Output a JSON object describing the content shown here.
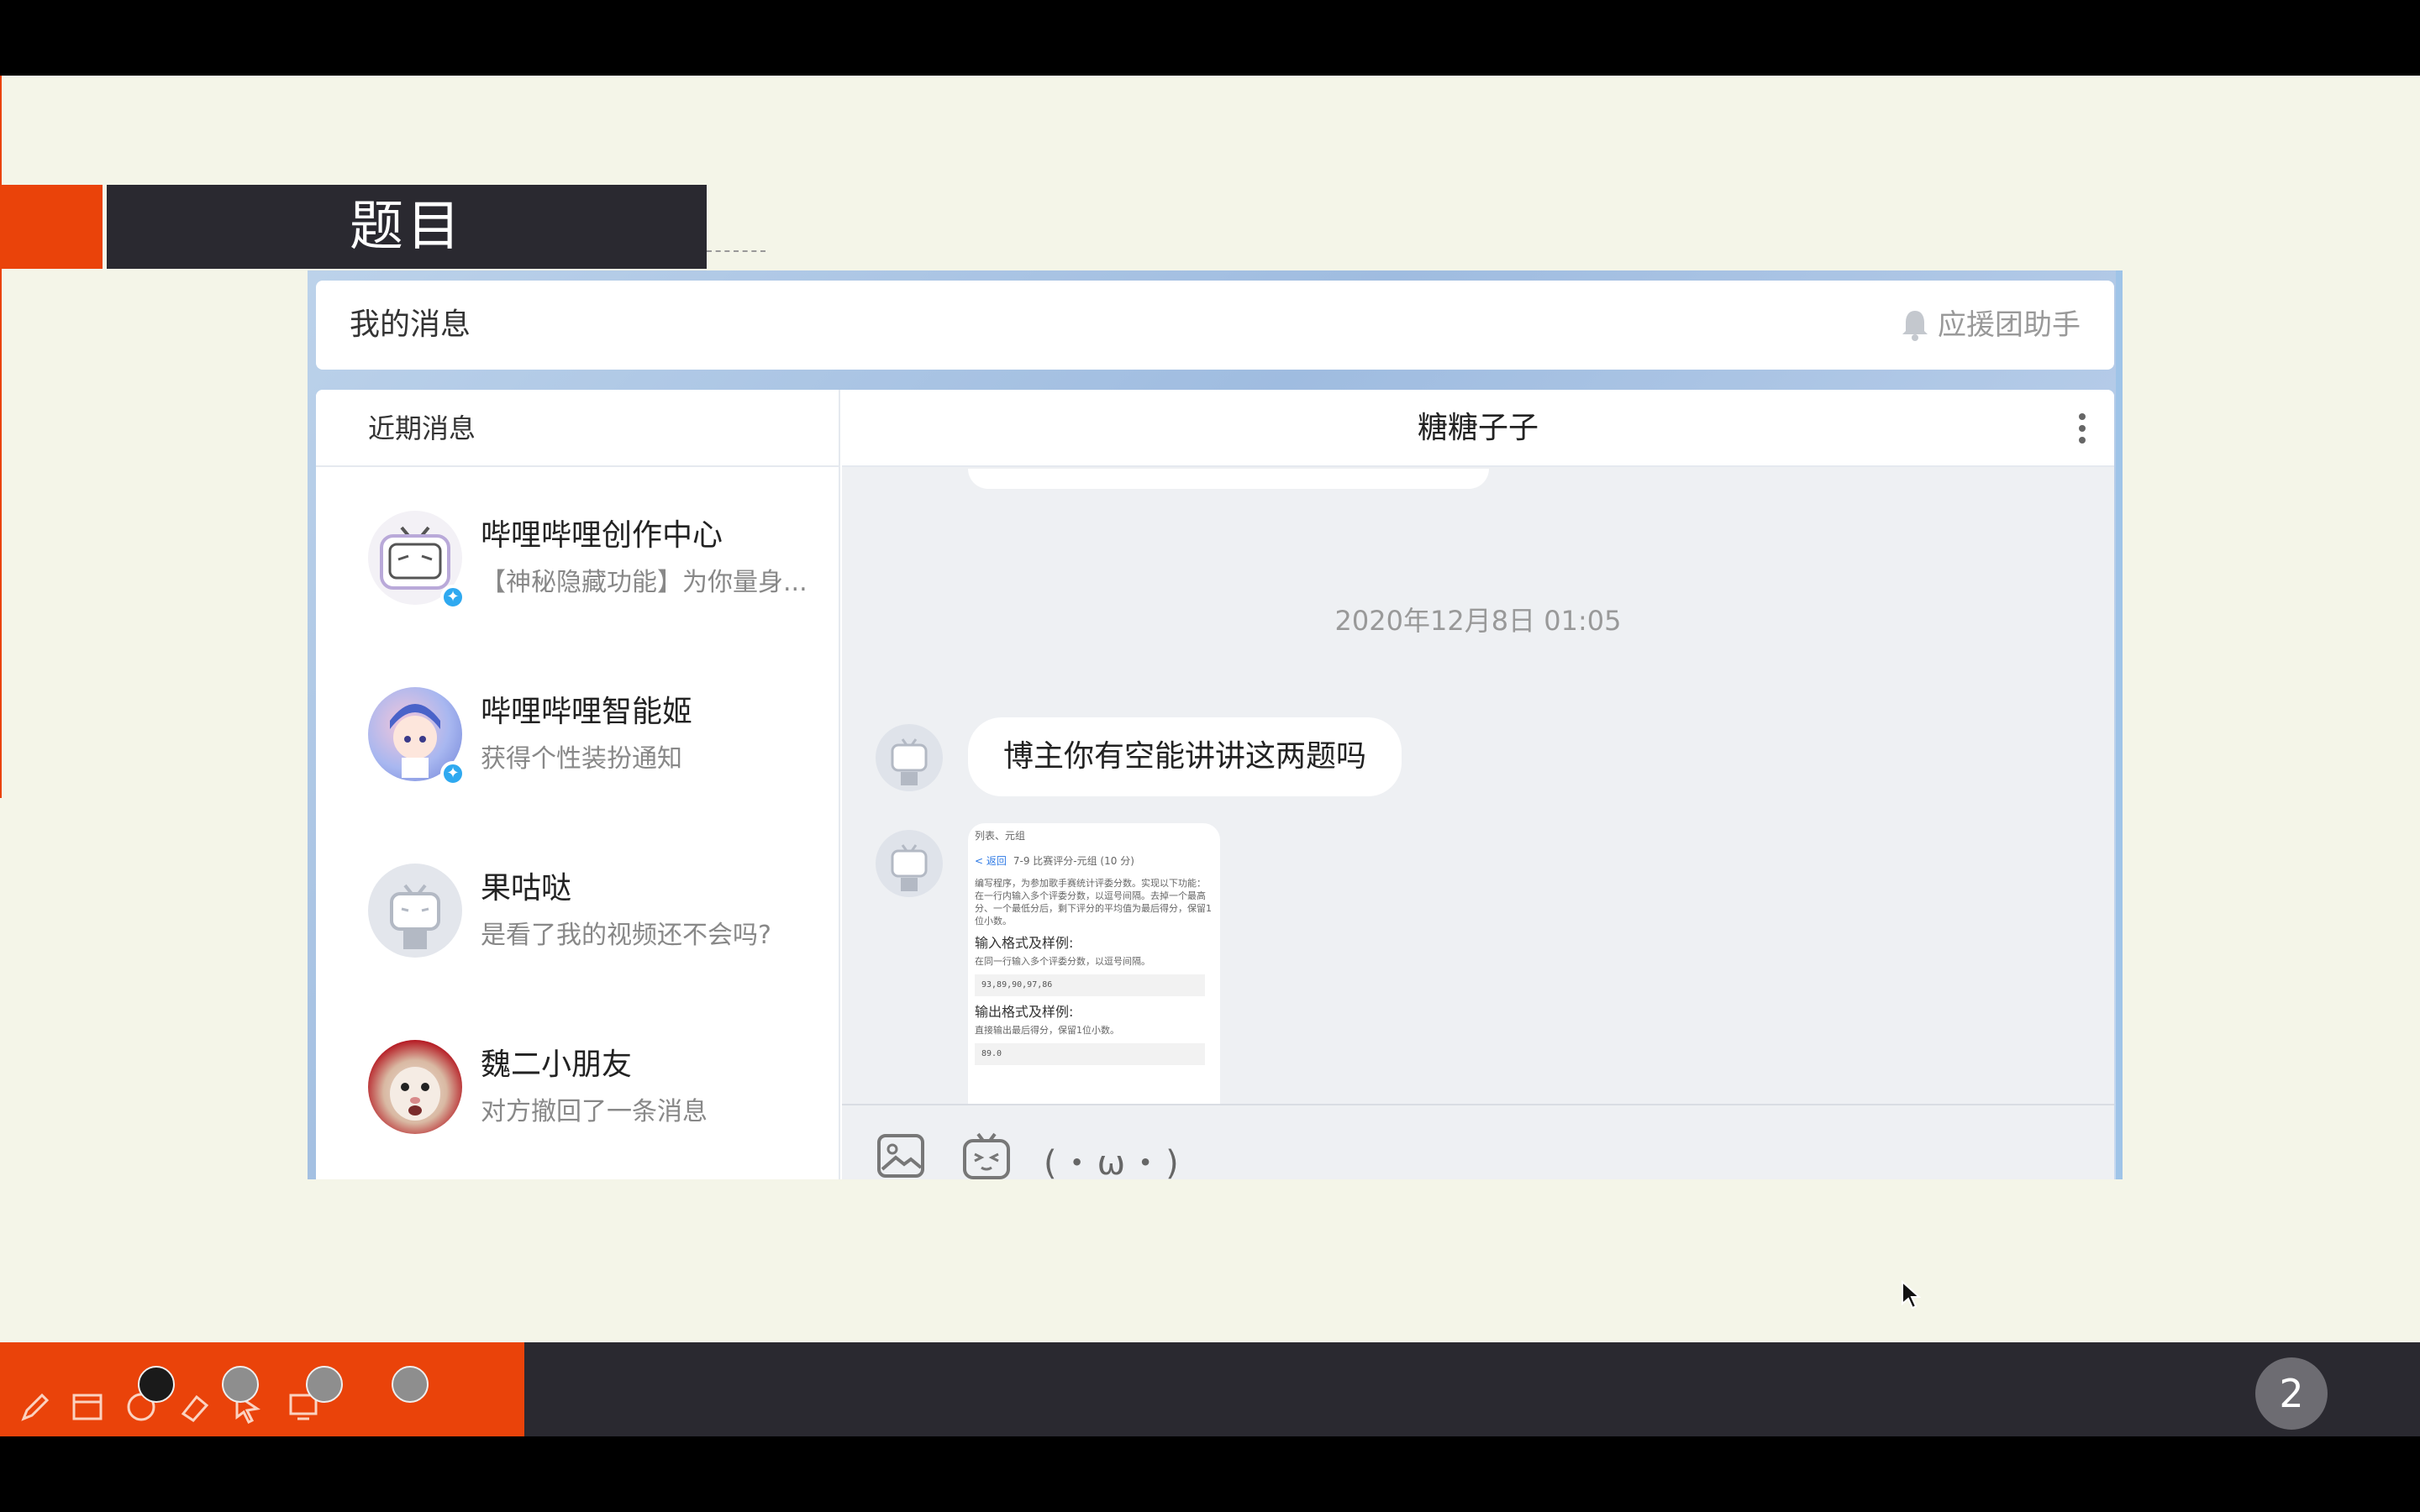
{
  "slide": {
    "title": "题目",
    "page_number": "2"
  },
  "app": {
    "header_title": "我的消息",
    "header_right": "应援团助手"
  },
  "sidebar": {
    "heading": "近期消息",
    "conversations": [
      {
        "name": "哔哩哔哩创作中心",
        "preview": "【神秘隐藏功能】为你量身..."
      },
      {
        "name": "哔哩哔哩智能姬",
        "preview": "获得个性装扮通知"
      },
      {
        "name": "果咕哒",
        "preview": "是看了我的视频还不会吗?"
      },
      {
        "name": "魏二小朋友",
        "preview": "对方撤回了一条消息"
      }
    ]
  },
  "chat": {
    "contact_name": "糖糖子子",
    "timestamp": "2020年12月8日 01:05",
    "message_text": "博主你有空能讲讲这两题吗",
    "image_doc": {
      "crumb": "列表、元组",
      "back": "< 返回",
      "problem": "7-9 比赛评分-元组 (10 分)",
      "score": "(10分)",
      "desc": "编写程序，为参加歌手赛统计评委分数。实现以下功能：在一行内输入多个评委分数，以逗号间隔。去掉一个最高分、一个最低分后，剩下评分的平均值为最后得分，保留1位小数。",
      "input_heading": "输入格式及样例:",
      "input_desc": "在同一行输入多个评委分数，以逗号间隔。",
      "input_sample": "93,89,90,97,86",
      "output_heading": "输出格式及样例:",
      "output_desc": "直接输出最后得分，保留1位小数。",
      "output_sample": "89.0"
    },
    "kaomoji": "(・ω・)"
  },
  "colors": {
    "accent": "#ea430a",
    "dark_bar": "#2a2930",
    "slide_bg": "#f4f5e8",
    "badge_blue": "#2fa9f0"
  }
}
